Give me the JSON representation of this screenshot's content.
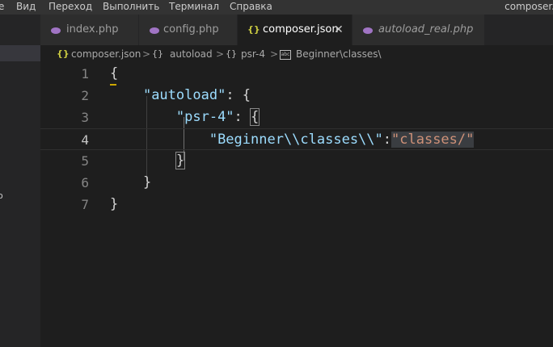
{
  "menubar": {
    "items": [
      "е",
      "Вид",
      "Переход",
      "Выполнить",
      "Терминал",
      "Справка"
    ],
    "window_title": "composer."
  },
  "sidebar": {
    "edge_glyph": "o"
  },
  "tabs": [
    {
      "label": "index.php",
      "icon": "php-icon",
      "active": false,
      "italic": false
    },
    {
      "label": "config.php",
      "icon": "php-icon",
      "active": false,
      "italic": false
    },
    {
      "label": "composer.json",
      "icon": "json-icon",
      "active": true,
      "italic": false,
      "close": "✕"
    },
    {
      "label": "autoload_real.php",
      "icon": "php-icon",
      "active": false,
      "italic": true
    }
  ],
  "json_icon_glyph": "{}",
  "breadcrumb": {
    "items": [
      "composer.json",
      "autoload",
      "psr-4",
      "Beginner\\classes\\"
    ],
    "separator": ">",
    "obj_glyph": "{}",
    "str_glyph": "abc"
  },
  "editor": {
    "line_numbers": [
      "1",
      "2",
      "3",
      "4",
      "5",
      "6",
      "7"
    ],
    "active_line": 4,
    "lines": [
      {
        "indent": "",
        "parts": [
          {
            "t": "{",
            "c": "punc"
          }
        ]
      },
      {
        "indent": "    ",
        "parts": [
          {
            "t": "\"autoload\"",
            "c": "key"
          },
          {
            "t": ": {",
            "c": "punc"
          }
        ]
      },
      {
        "indent": "        ",
        "parts": [
          {
            "t": "\"psr-4\"",
            "c": "key"
          },
          {
            "t": ": ",
            "c": "punc"
          },
          {
            "t": "{",
            "c": "punc"
          }
        ]
      },
      {
        "indent": "            ",
        "parts": [
          {
            "t": "\"Beginner\\\\classes\\\\\"",
            "c": "key"
          },
          {
            "t": ":",
            "c": "punc"
          },
          {
            "t": "\"classes/\"",
            "c": "strv"
          }
        ]
      },
      {
        "indent": "        ",
        "parts": [
          {
            "t": "}",
            "c": "punc"
          }
        ]
      },
      {
        "indent": "    ",
        "parts": [
          {
            "t": "}",
            "c": "punc"
          }
        ]
      },
      {
        "indent": "",
        "parts": [
          {
            "t": "}",
            "c": "punc"
          }
        ]
      }
    ]
  },
  "colors": {
    "background": "#1e1e1e",
    "key": "#9cdcfe",
    "string": "#ce9178",
    "json_icon": "#cbcb41",
    "php_icon": "#a074c4"
  }
}
